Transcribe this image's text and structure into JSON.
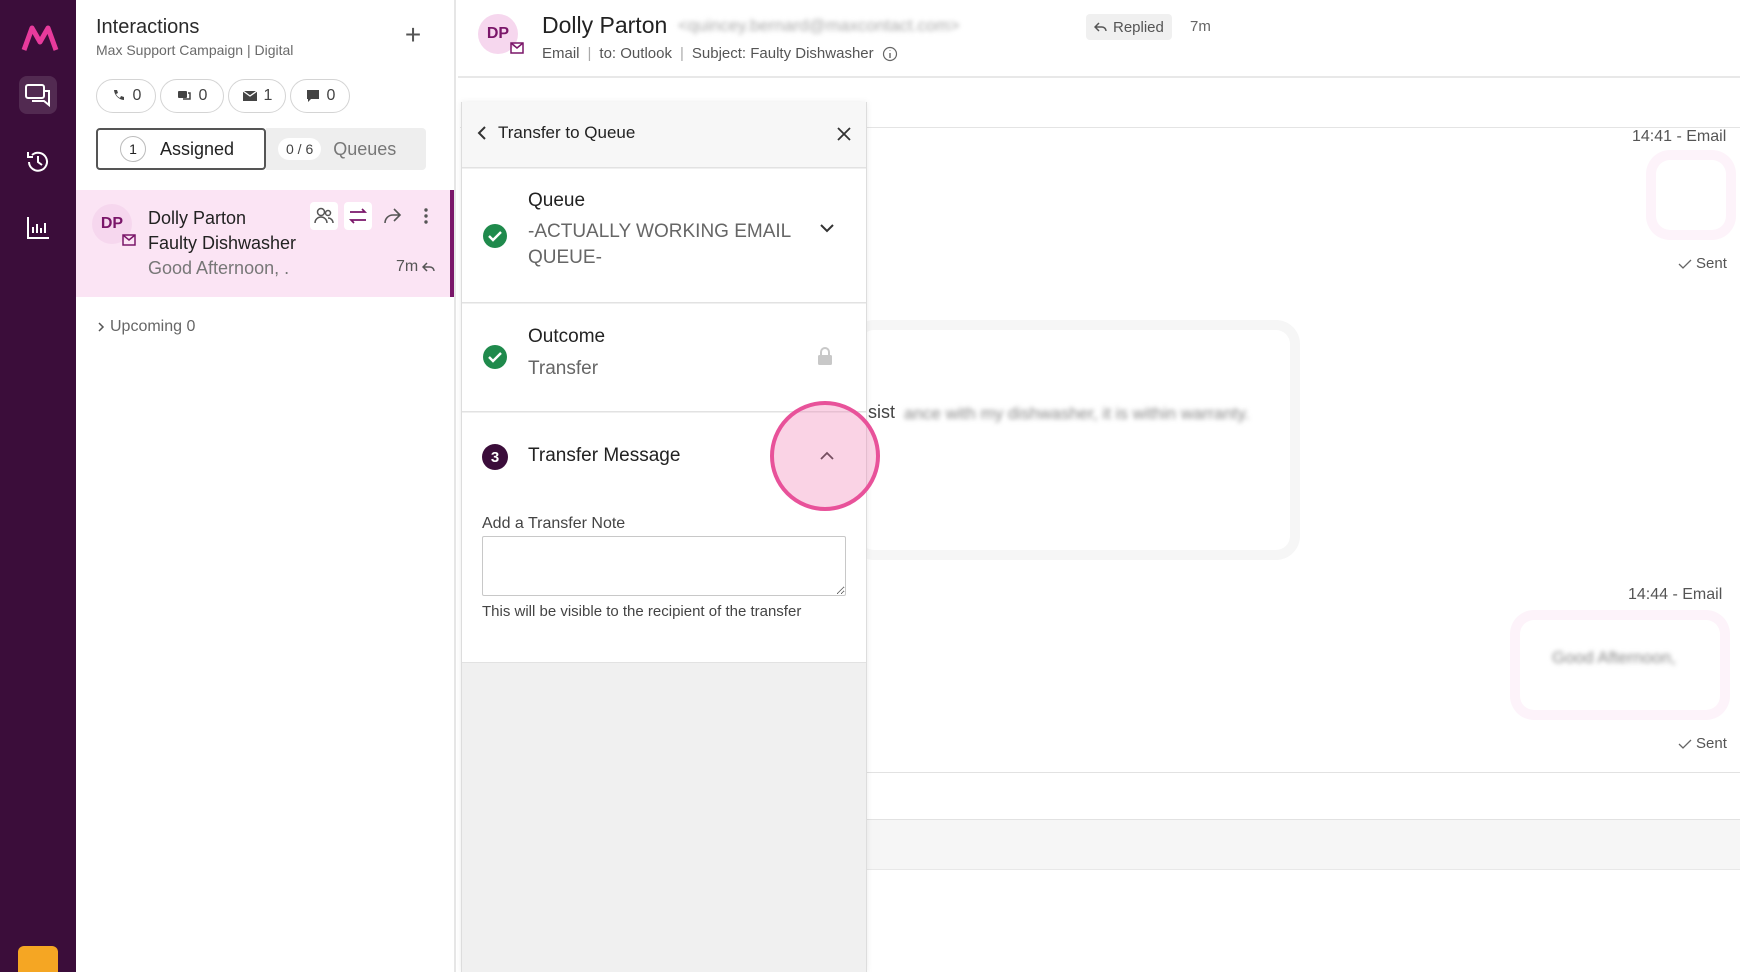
{
  "rail": {
    "logo": "M",
    "items": [
      "chat-icon",
      "history-icon",
      "chart-icon"
    ],
    "brand_color": "#3b0d3a"
  },
  "interactions": {
    "title": "Interactions",
    "subtitle": "Max Support Campaign | Digital",
    "add": "+",
    "channel_counts": [
      {
        "icon": "phone-icon",
        "count": "0"
      },
      {
        "icon": "chat-icon",
        "count": "0"
      },
      {
        "icon": "mail-icon",
        "count": "1"
      },
      {
        "icon": "message-icon",
        "count": "0"
      }
    ],
    "assigned": {
      "count": "1",
      "label": "Assigned"
    },
    "queues": {
      "count": "0 / 6",
      "label": "Queues"
    },
    "conversation": {
      "initials": "DP",
      "name": "Dolly Parton",
      "subject": "Faulty Dishwasher",
      "preview": "Good Afternoon, .",
      "time": "7m"
    },
    "upcoming": "Upcoming 0"
  },
  "header": {
    "initials": "DP",
    "name": "Dolly Parton",
    "email": "<quincey.bernard@maxcontact.com>",
    "status": "Replied",
    "ago": "7m",
    "channel": "Email",
    "to": "to: Outlook",
    "subject": "Subject: Faulty Dishwasher"
  },
  "messages": {
    "ts1": "14:41 - Email",
    "sent1": "Sent",
    "body_fragment": "sist",
    "body_blur": "ance with my dishwasher, it is within warranty.",
    "ts2": "14:44 - Email",
    "reply_blur": "Good Afternoon,",
    "sent2": "Sent"
  },
  "drawer": {
    "title": "Transfer to Queue",
    "queue_label": "Queue",
    "queue_value_line1": "-ACTUALLY WORKING EMAIL",
    "queue_value_line2": "QUEUE-",
    "outcome_label": "Outcome",
    "outcome_value": "Transfer",
    "step3_number": "3",
    "message_label": "Transfer Message",
    "note_label": "Add a Transfer Note",
    "note_value": "",
    "note_help": "This will be visible to the recipient of the transfer"
  }
}
